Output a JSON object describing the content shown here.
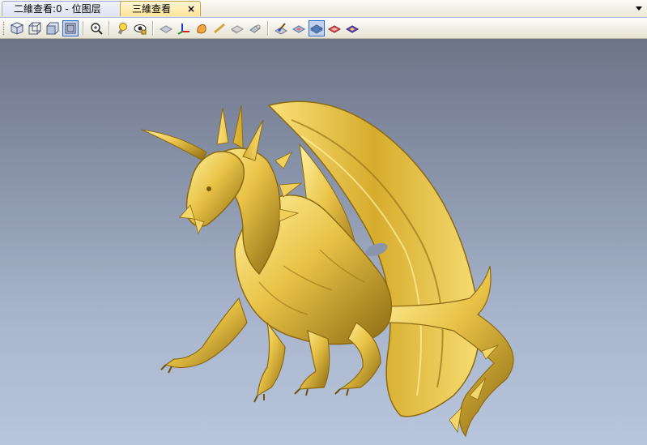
{
  "tabs": [
    {
      "label": "二維查看:0 - 位图层",
      "active": false
    },
    {
      "label": "三維查看",
      "active": true
    }
  ],
  "close_glyph": "×",
  "toolbar": {
    "icons": [
      "iso-view-icon",
      "wireframe-cube-icon",
      "front-view-icon",
      "box-view-icon",
      "zoom-in-icon",
      "light-bulb-icon",
      "eye-view-icon",
      "plane-icon",
      "axes-icon",
      "material-icon",
      "line-icon",
      "flat-surface-icon",
      "shade-icon",
      "paint-brush-icon",
      "layer-flat-icon",
      "layer-blue-icon",
      "layer-red-icon",
      "layer-purple-icon"
    ],
    "pressed": [
      "box-view-icon",
      "layer-blue-icon"
    ]
  },
  "viewport": {
    "background_top": "#6d7488",
    "background_bottom": "#b8c6dd",
    "model_color": "#e8c24a"
  }
}
